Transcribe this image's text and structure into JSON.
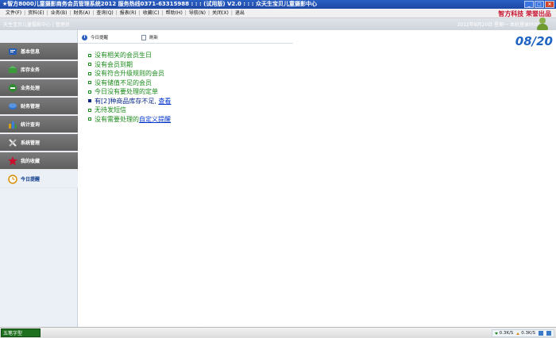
{
  "window": {
    "title": "★智方8000儿童摄影商务会员管理系统2012  服务热线0371-63315988 : : : (试用版)  V2.0  : : :  众天生宝贝儿童摄影中心",
    "controls": [
      "_",
      "□",
      "×"
    ]
  },
  "menu": {
    "items": [
      "文件(F)",
      "资料(E)",
      "业务(B)",
      "财务(A)",
      "查询(Q)",
      "报表(R)",
      "收藏(C)",
      "帮助(H)",
      "导航(N)",
      "关闭(X)",
      "退出"
    ],
    "brand": "智方科技  荣誉出品"
  },
  "banner": {
    "left": "天生宝贝儿童摄影中心 | 管理员",
    "right": "2012年8月20日  星期一  本机登录时间"
  },
  "sidebar": {
    "items": [
      {
        "label": "基本信息",
        "icon": "basic-info-icon",
        "color": "#2b5db3"
      },
      {
        "label": "库存业务",
        "icon": "inventory-icon",
        "color": "#3b9a3b"
      },
      {
        "label": "业务处理",
        "icon": "business-icon",
        "color": "#2f8a2f"
      },
      {
        "label": "财务管理",
        "icon": "finance-icon",
        "color": "#2b6fcf"
      },
      {
        "label": "统计查询",
        "icon": "statistics-icon",
        "color": "#d4a016"
      },
      {
        "label": "系统管理",
        "icon": "tools-icon",
        "color": "#666666"
      },
      {
        "label": "我的收藏",
        "icon": "star-icon",
        "color": "#c8102e"
      },
      {
        "label": "今日提醒",
        "icon": "clock-icon",
        "color": "#d98a00"
      }
    ],
    "active_index": 7
  },
  "content": {
    "tabs": {
      "today_label": "今日提醒",
      "refresh_label": "刷新"
    },
    "date": "08/20",
    "notices": [
      {
        "text": "没有相关的会员生日",
        "type": "normal"
      },
      {
        "text": "没有会员到期",
        "type": "normal"
      },
      {
        "text": "没有符合升级规则的会员",
        "type": "normal"
      },
      {
        "text": "没有储值不足的会员",
        "type": "normal"
      },
      {
        "text": "今日没有要处理的定单",
        "type": "normal"
      },
      {
        "text": "有[2]种商品库存不足,",
        "link": "查看",
        "type": "warn"
      },
      {
        "text": "无待发短信",
        "type": "normal"
      },
      {
        "text": "没有需要处理的",
        "link": "自定义提醒",
        "type": "normal"
      }
    ]
  },
  "statusbar": {
    "ime": "五笔字型",
    "down_speed": "0.3K/S",
    "up_speed": "0.3K/S"
  }
}
